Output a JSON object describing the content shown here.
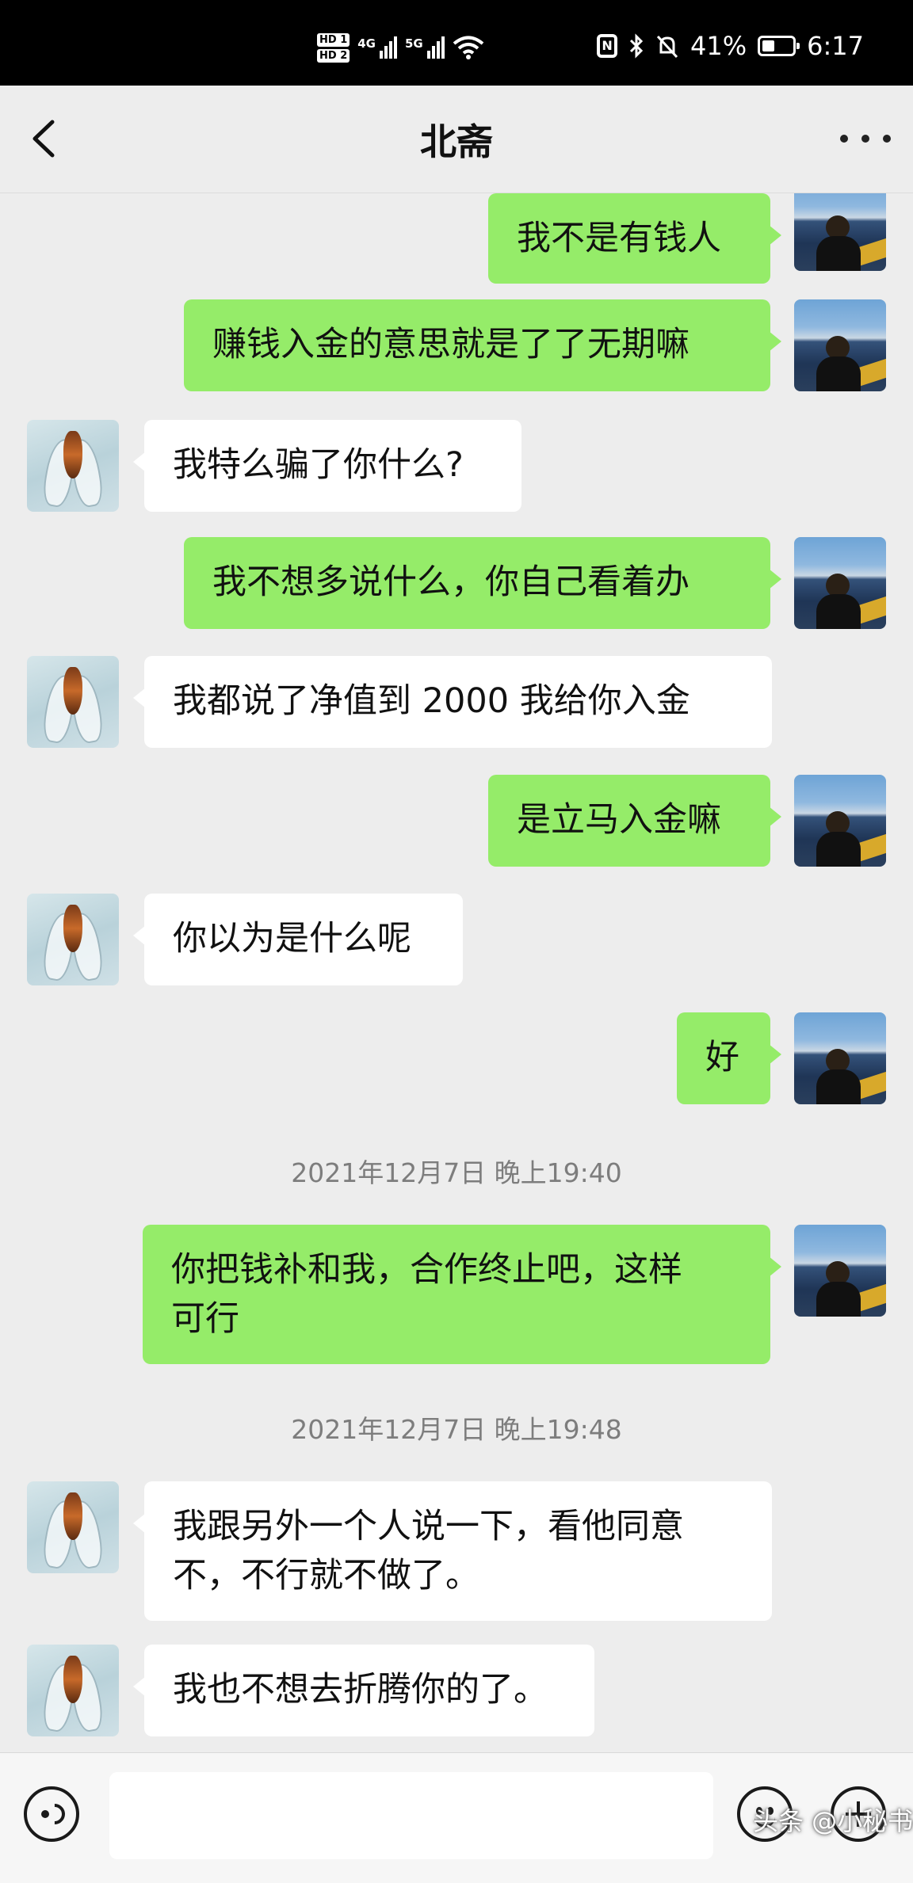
{
  "status_bar": {
    "hd1": "HD 1",
    "hd2": "HD 2",
    "net1": "4G",
    "net2": "5G",
    "battery_text": "41%",
    "battery_level": 0.41,
    "time": "6:17"
  },
  "nav": {
    "title": "北斋"
  },
  "messages": [
    {
      "side": "out",
      "text": "我不是有钱人"
    },
    {
      "side": "out",
      "text": "赚钱入金的意思就是了了无期嘛"
    },
    {
      "side": "in",
      "text": "我特么骗了你什么?"
    },
    {
      "side": "out",
      "text": "我不想多说什么，你自己看着办"
    },
    {
      "side": "in",
      "text": "我都说了净值到 2000 我给你入金"
    },
    {
      "side": "out",
      "text": "是立马入金嘛"
    },
    {
      "side": "in",
      "text": "你以为是什么呢"
    },
    {
      "side": "out",
      "text": "好"
    },
    {
      "timestamp": "2021年12月7日 晚上19:40"
    },
    {
      "side": "out",
      "text": "你把钱补和我，合作终止吧，这样\n可行"
    },
    {
      "timestamp": "2021年12月7日 晚上19:48"
    },
    {
      "side": "in",
      "text": "我跟另外一个人说一下，看他同意\n不，不行就不做了。"
    },
    {
      "side": "in",
      "text": "我也不想去折腾你的了。"
    }
  ],
  "watermark": "头条 @小秘书",
  "colors": {
    "outgoing_bubble": "#95ec69",
    "incoming_bubble": "#ffffff",
    "chat_background": "#ededed"
  },
  "icons": {
    "back": "chevron-left-icon",
    "more": "more-dots-icon",
    "voice": "voice-icon",
    "emoji": "emoji-icon",
    "plus": "plus-icon"
  }
}
